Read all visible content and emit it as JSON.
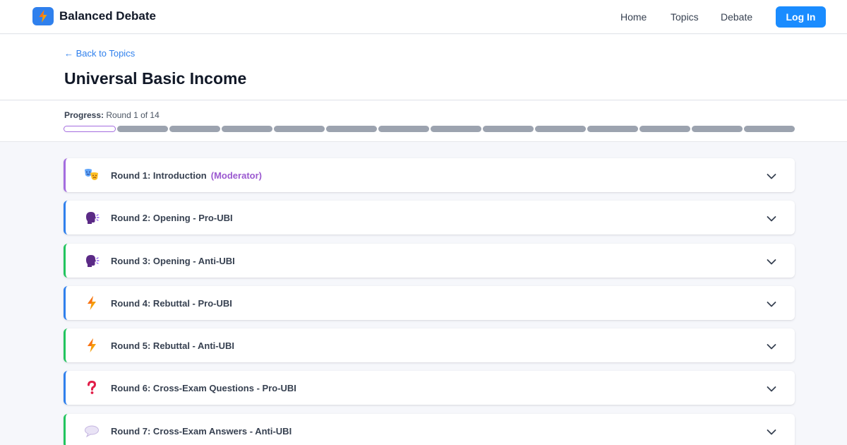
{
  "app": {
    "name": "Balanced Debate"
  },
  "nav": {
    "home": "Home",
    "topics": "Topics",
    "debate": "Debate",
    "login": "Log In"
  },
  "page": {
    "back_link": "← Back to Topics",
    "title": "Universal Basic Income"
  },
  "progress": {
    "label": "Progress:",
    "text": "Round 1 of 14",
    "current": 1,
    "total": 14
  },
  "colors": {
    "accent": "#1a8cff",
    "moderator": "#a46ddf",
    "pro": "#2f80ed",
    "anti": "#22c55e"
  },
  "rounds": [
    {
      "label": "Round 1: Introduction",
      "role": "(Moderator)",
      "icon": "theater-masks-icon",
      "side": "moderator"
    },
    {
      "label": "Round 2: Opening - Pro-UBI",
      "role": "",
      "icon": "speaking-head-icon",
      "side": "pro"
    },
    {
      "label": "Round 3: Opening - Anti-UBI",
      "role": "",
      "icon": "speaking-head-icon",
      "side": "anti"
    },
    {
      "label": "Round 4: Rebuttal - Pro-UBI",
      "role": "",
      "icon": "lightning-icon",
      "side": "pro"
    },
    {
      "label": "Round 5: Rebuttal - Anti-UBI",
      "role": "",
      "icon": "lightning-icon",
      "side": "anti"
    },
    {
      "label": "Round 6: Cross-Exam Questions - Pro-UBI",
      "role": "",
      "icon": "question-mark-icon",
      "side": "pro"
    },
    {
      "label": "Round 7: Cross-Exam Answers - Anti-UBI",
      "role": "",
      "icon": "speech-bubble-icon",
      "side": "anti"
    }
  ]
}
